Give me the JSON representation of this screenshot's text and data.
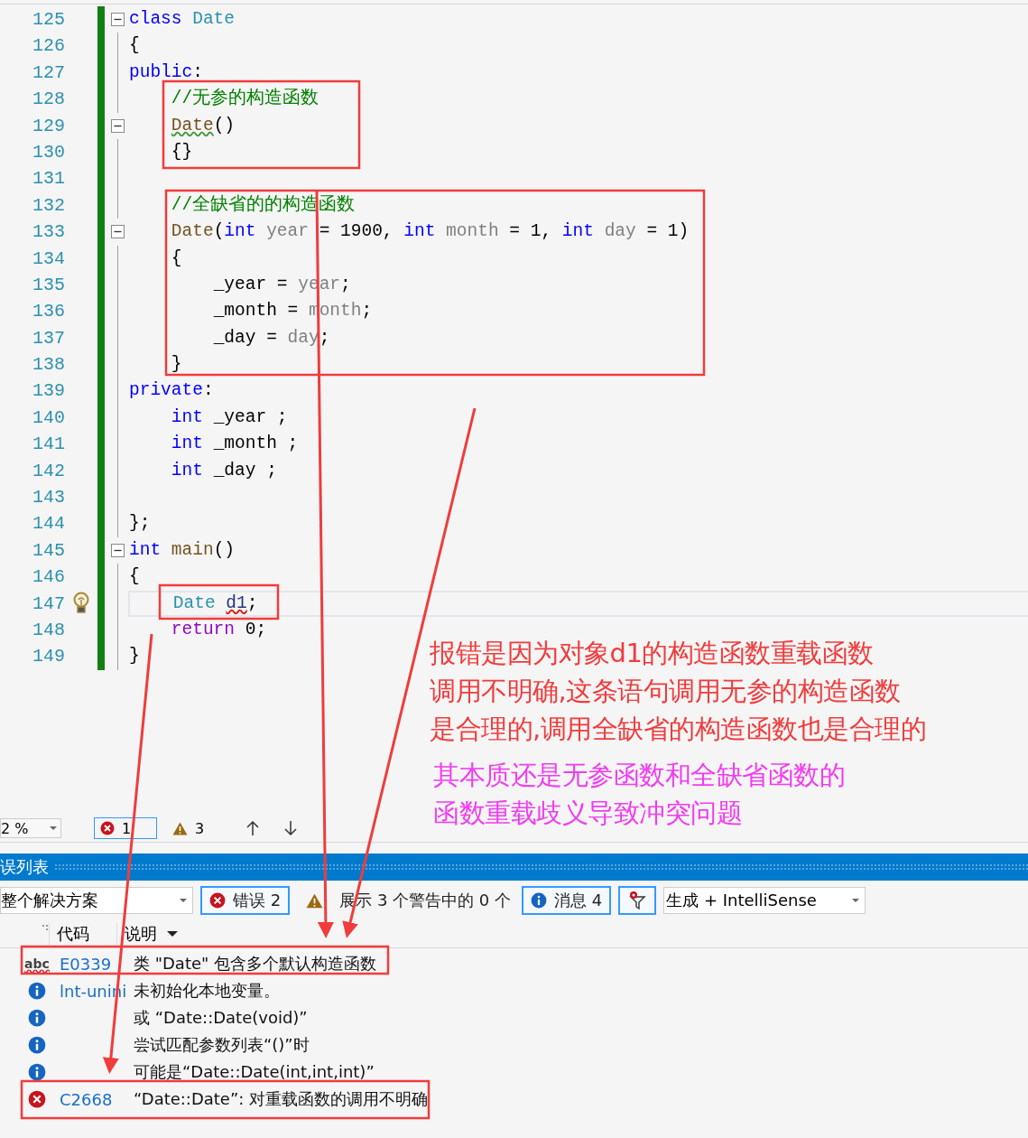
{
  "editor": {
    "lines": [
      {
        "number": "125",
        "fold_start": true,
        "current": false,
        "tokens": [
          {
            "text": "class ",
            "kind": "keyword"
          },
          {
            "text": "Date",
            "kind": "type"
          }
        ]
      },
      {
        "number": "126",
        "fold_start": false,
        "current": false,
        "tokens": [
          {
            "text": "{",
            "kind": "plain"
          }
        ]
      },
      {
        "number": "127",
        "fold_start": false,
        "current": false,
        "tokens": [
          {
            "text": "public",
            "kind": "keyword"
          },
          {
            "text": ":",
            "kind": "plain"
          }
        ]
      },
      {
        "number": "128",
        "fold_start": false,
        "current": false,
        "tokens": [
          {
            "text": "    //无参的构造函数",
            "kind": "comment"
          }
        ]
      },
      {
        "number": "129",
        "fold_start": true,
        "current": false,
        "tokens": [
          {
            "text": "    Date",
            "kind": "function",
            "color": "#3a9a3a"
          },
          {
            "text": "()",
            "kind": "plain"
          }
        ]
      },
      {
        "number": "130",
        "fold_start": false,
        "current": false,
        "tokens": [
          {
            "text": "    {}",
            "kind": "plain"
          }
        ]
      },
      {
        "number": "131",
        "fold_start": false,
        "current": false
      },
      {
        "number": "132",
        "fold_start": false,
        "current": false,
        "tokens": [
          {
            "text": "    //全缺省的的构造函数",
            "kind": "comment"
          }
        ]
      },
      {
        "number": "133",
        "fold_start": true,
        "current": false,
        "tokens": [
          {
            "text": "    Date",
            "kind": "function"
          },
          {
            "text": "(",
            "kind": "plain"
          },
          {
            "text": "int ",
            "kind": "keyword"
          },
          {
            "text": "year",
            "kind": "param"
          },
          {
            "text": " = 1900, ",
            "kind": "plain"
          },
          {
            "text": "int ",
            "kind": "keyword"
          },
          {
            "text": "month",
            "kind": "param"
          },
          {
            "text": " = 1, ",
            "kind": "plain"
          },
          {
            "text": "int ",
            "kind": "keyword"
          },
          {
            "text": "day",
            "kind": "param"
          },
          {
            "text": " = 1)",
            "kind": "plain"
          }
        ]
      },
      {
        "number": "134",
        "fold_start": false,
        "current": false,
        "tokens": [
          {
            "text": "    {",
            "kind": "plain"
          }
        ]
      },
      {
        "number": "135",
        "fold_start": false,
        "current": false,
        "tokens": [
          {
            "text": "        _year = ",
            "kind": "plain"
          },
          {
            "text": "year",
            "kind": "param"
          },
          {
            "text": ";",
            "kind": "plain"
          }
        ]
      },
      {
        "number": "136",
        "fold_start": false,
        "current": false,
        "tokens": [
          {
            "text": "        _month = ",
            "kind": "plain"
          },
          {
            "text": "month",
            "kind": "param"
          },
          {
            "text": ";",
            "kind": "plain"
          }
        ]
      },
      {
        "number": "137",
        "fold_start": false,
        "current": false,
        "tokens": [
          {
            "text": "        _day = ",
            "kind": "plain"
          },
          {
            "text": "day",
            "kind": "param"
          },
          {
            "text": ";",
            "kind": "plain"
          }
        ]
      },
      {
        "number": "138",
        "fold_start": false,
        "current": false,
        "tokens": [
          {
            "text": "    }",
            "kind": "plain"
          }
        ]
      },
      {
        "number": "139",
        "fold_start": false,
        "current": false,
        "tokens": [
          {
            "text": "private",
            "kind": "keyword"
          },
          {
            "text": ":",
            "kind": "plain"
          }
        ]
      },
      {
        "number": "140",
        "fold_start": false,
        "current": false,
        "tokens": [
          {
            "text": "    int",
            "kind": "keyword"
          },
          {
            "text": " _year ;",
            "kind": "plain"
          }
        ]
      },
      {
        "number": "141",
        "fold_start": false,
        "current": false,
        "tokens": [
          {
            "text": "    int",
            "kind": "keyword"
          },
          {
            "text": " _month ;",
            "kind": "plain"
          }
        ]
      },
      {
        "number": "142",
        "fold_start": false,
        "current": false,
        "tokens": [
          {
            "text": "    int",
            "kind": "keyword"
          },
          {
            "text": " _day ;",
            "kind": "plain"
          }
        ]
      },
      {
        "number": "143",
        "fold_start": false,
        "current": false
      },
      {
        "number": "144",
        "fold_start": false,
        "current": false,
        "tokens": [
          {
            "text": "};",
            "kind": "plain"
          }
        ]
      },
      {
        "number": "145",
        "fold_start": true,
        "current": false,
        "tokens": [
          {
            "text": "int ",
            "kind": "keyword"
          },
          {
            "text": "main",
            "kind": "function"
          },
          {
            "text": "()",
            "kind": "plain"
          }
        ]
      },
      {
        "number": "146",
        "fold_start": false,
        "current": false,
        "tokens": [
          {
            "text": "{",
            "kind": "plain"
          }
        ]
      },
      {
        "number": "147",
        "fold_start": false,
        "current": true,
        "tokens": [
          {
            "text": "    Date ",
            "kind": "type"
          },
          {
            "text": "d1",
            "kind": "local",
            "color": "#e51400"
          },
          {
            "text": ";",
            "kind": "plain"
          }
        ]
      },
      {
        "number": "148",
        "fold_start": false,
        "current": false,
        "tokens": [
          {
            "text": "    return",
            "kind": "control"
          },
          {
            "text": " 0;",
            "kind": "plain"
          }
        ]
      },
      {
        "number": "149",
        "fold_start": false,
        "current": false,
        "tokens": [
          {
            "text": "}",
            "kind": "plain"
          }
        ]
      }
    ]
  },
  "annotations": [
    {
      "kind": "explanation",
      "lines": [
        "报错是因为对象d1的构造函数重载函数",
        "调用不明确,这条语句调用无参的构造函数",
        "是合理的,调用全缺省的构造函数也是合理的"
      ]
    },
    {
      "kind": "summary",
      "lines": [
        "其本质还是无参函数和全缺省函数的",
        "函数重载歧义导致冲突问题"
      ]
    }
  ],
  "editor_status": {
    "zoom": "2 %",
    "errors": "1",
    "warnings": "3"
  },
  "error_list": {
    "title": "误列表",
    "scope": "整个解决方案",
    "filters": [
      {
        "kind": "error",
        "label": "错误 2",
        "selected": true
      },
      {
        "kind": "warning",
        "label": "展示 3 个警告中的 0 个",
        "selected": false
      },
      {
        "kind": "info",
        "label": "消息 4",
        "selected": true
      },
      {
        "kind": "filter",
        "selected": true
      }
    ],
    "source": "生成 + IntelliSense",
    "columns": [
      "代码",
      "说明"
    ],
    "rows": [
      {
        "kind": "spelling",
        "icon_label": "abc",
        "code": "E0339",
        "description": "类 \"Date\" 包含多个默认构造函数"
      },
      {
        "kind": "info",
        "code": "lnt-unini",
        "description": "未初始化本地变量。"
      },
      {
        "kind": "info",
        "description": "或  “Date::Date(void)”"
      },
      {
        "kind": "info",
        "description": "尝试匹配参数列表“()”时"
      },
      {
        "kind": "info",
        "description": "可能是“Date::Date(int,int,int)”"
      },
      {
        "kind": "error",
        "code": "C2668",
        "description": "“Date::Date”: 对重载函数的调用不明确"
      }
    ]
  }
}
